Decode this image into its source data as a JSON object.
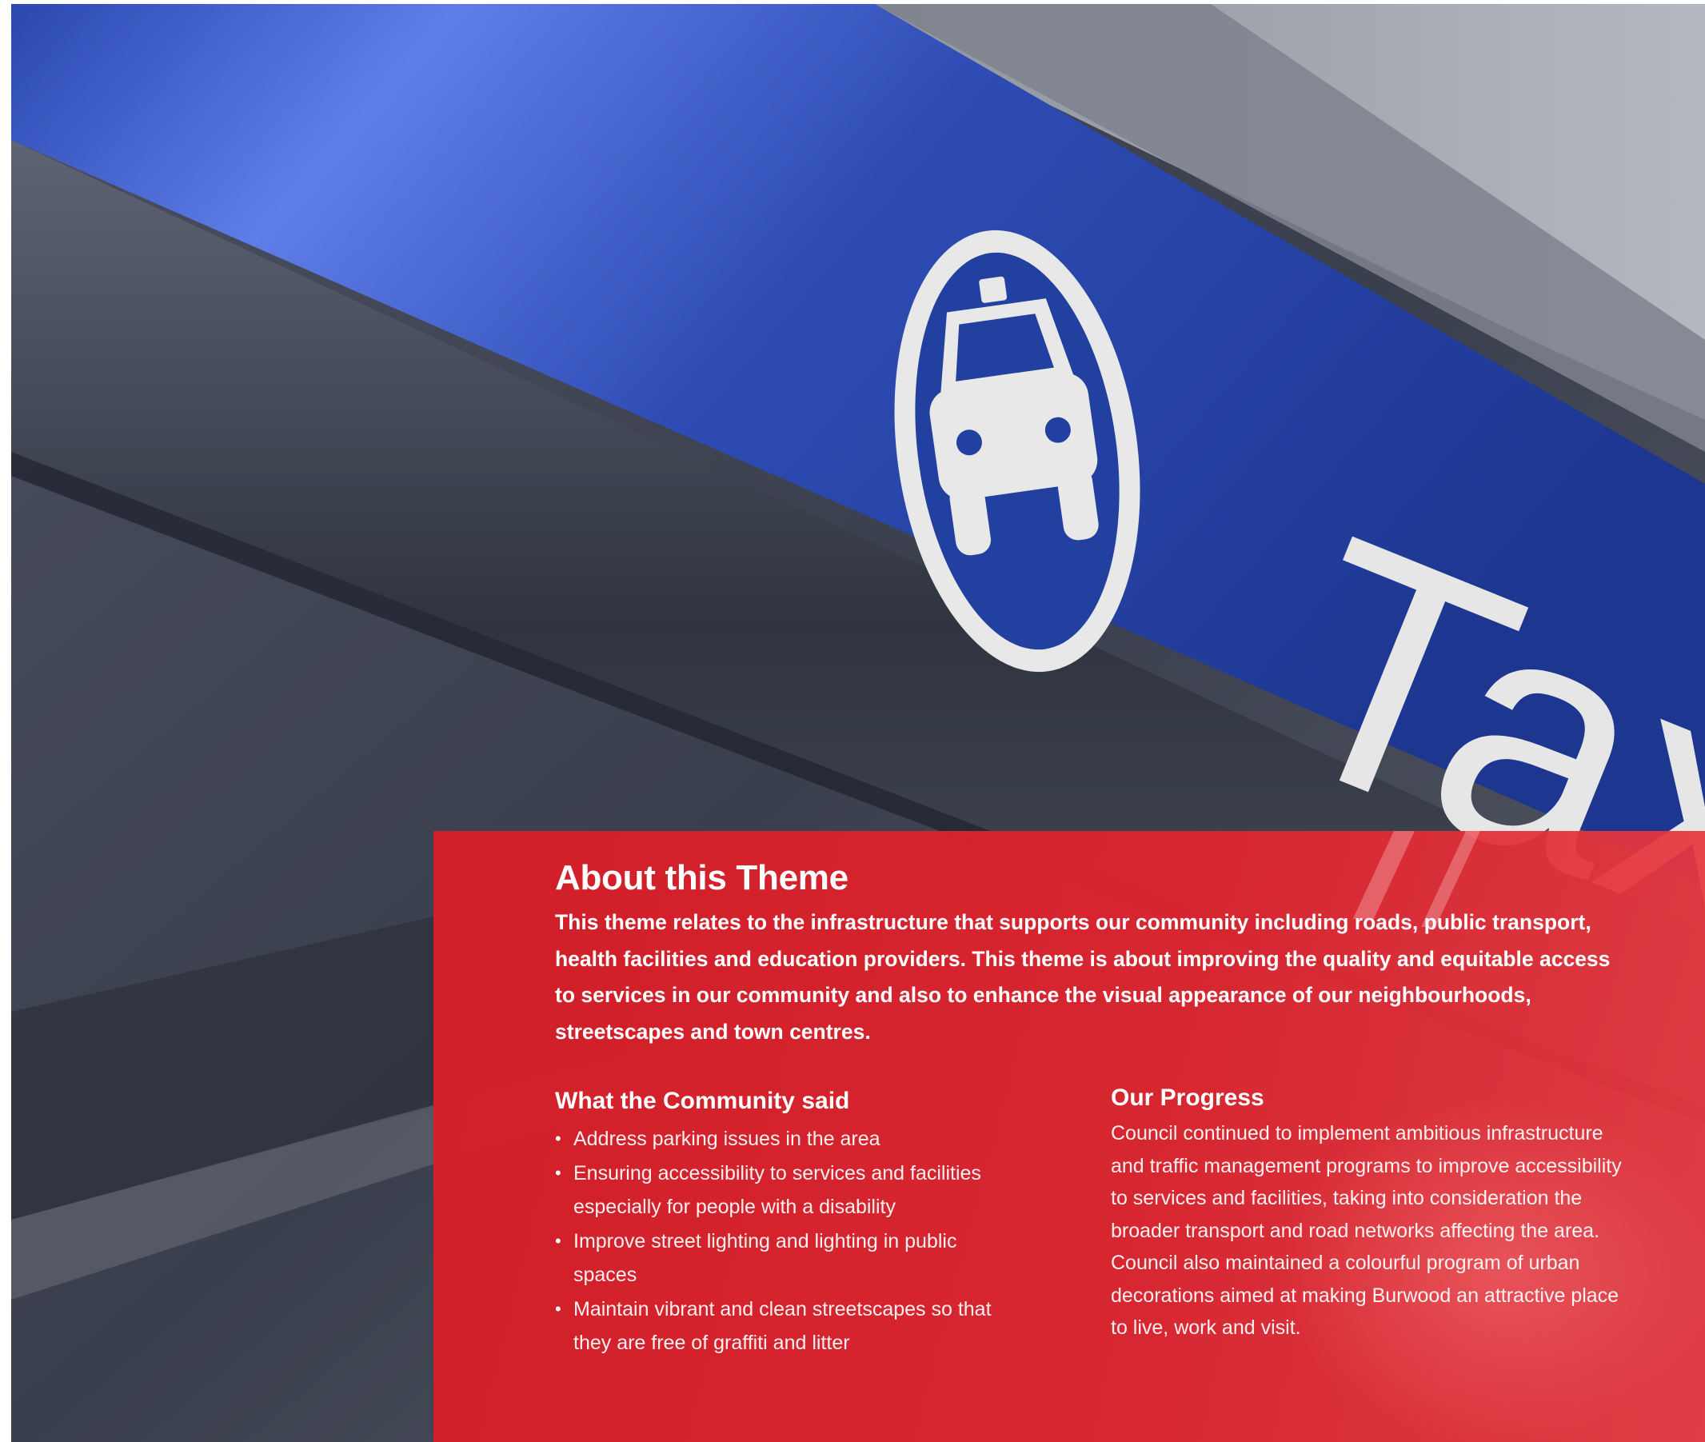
{
  "hero": {
    "sign_text": "Taxi",
    "sign_icon": "taxi-icon",
    "colors": {
      "sign_blue": "#2f4fb0",
      "panel_red": "#d81f2a"
    }
  },
  "about": {
    "title": "About this Theme",
    "intro": "This theme relates to the infrastructure that supports our community including roads, public transport, health facilities and education providers. This theme is about improving the quality and equitable access to services in our community and also to enhance the visual appearance of our neighbourhoods, streetscapes and town centres."
  },
  "community": {
    "heading": "What the Community said",
    "items": [
      "Address parking issues in the area",
      "Ensuring accessibility to services and facilities especially for people with a disability",
      "Improve street lighting and lighting in public spaces",
      "Maintain vibrant and clean streetscapes so that they are free of graffiti and litter"
    ]
  },
  "progress": {
    "heading": "Our Progress",
    "text": "Council continued to implement ambitious infrastructure and traffic management programs to improve accessibility to services and facilities, taking into consideration the broader transport and road networks affecting the area. Council also maintained a colourful program of urban decorations aimed at making Burwood an attractive place to live, work and visit."
  }
}
